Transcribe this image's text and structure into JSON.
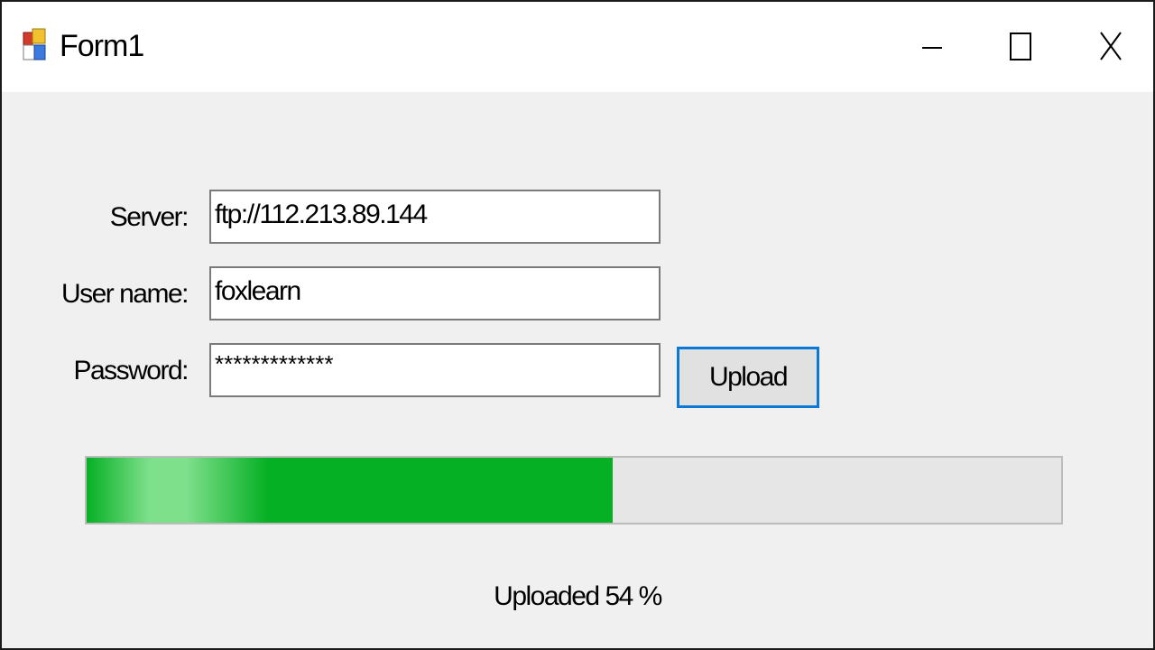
{
  "window": {
    "title": "Form1",
    "icon": "winforms-app-icon",
    "controls": {
      "minimize": "minimize-icon",
      "maximize": "maximize-icon",
      "close": "close-icon"
    }
  },
  "form": {
    "server_label": "Server:",
    "server_value": "ftp://112.213.89.144",
    "username_label": "User name:",
    "username_value": "foxlearn",
    "password_label": "Password:",
    "password_value": "*************",
    "upload_button": "Upload"
  },
  "progress": {
    "percent": 54,
    "status_text": "Uploaded 54 %",
    "fill_color": "#06b025",
    "track_color": "#e6e6e6"
  },
  "accent_color": "#0a78d7"
}
